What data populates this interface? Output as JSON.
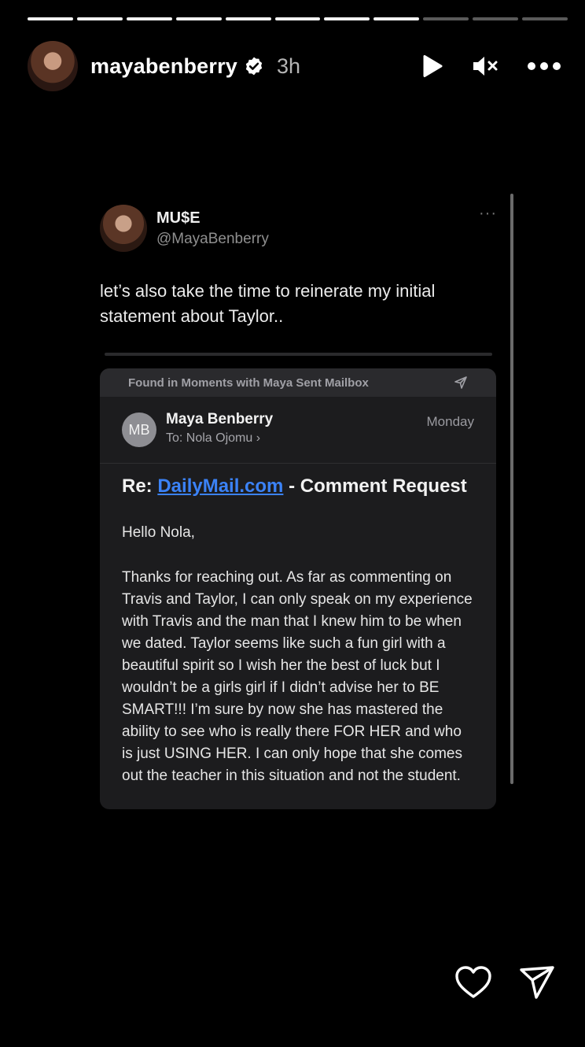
{
  "story": {
    "segments_total": 11,
    "segments_done": 8,
    "username": "mayabenberry",
    "time": "3h",
    "icons": {
      "verified": "verified-badge-icon",
      "play": "play-icon",
      "mute": "muted-speaker-icon",
      "more": "more-options-icon"
    }
  },
  "post": {
    "display_name": "MU$E",
    "handle": "@MayaBenberry",
    "more": "···",
    "text": "let’s also take the time to reinerate my initial statement about Taylor.."
  },
  "email": {
    "found_in": "Found in Moments with Maya Sent Mailbox",
    "avatar_initials": "MB",
    "sender": "Maya Benberry",
    "to_label": "To:",
    "to_name": "Nola Ojomu",
    "chevron": "›",
    "date": "Monday",
    "subject_prefix": "Re: ",
    "subject_link": "DailyMail.com",
    "subject_suffix": " - Comment Request",
    "greeting": "Hello Nola,",
    "body": "Thanks for reaching out. As far as commenting on Travis and Taylor, I can only speak on my experience with Travis and the man that I knew him to be when we dated. Taylor seems like such a fun girl with a beautiful spirit so I wish her the best of luck but I wouldn’t be a girls girl if I didn’t advise her to BE SMART!!! I’m sure by now she has mastered the ability to see who is really there FOR HER and who is just USING HER. I can only hope that she comes out the teacher in this situation and not the student."
  },
  "footer": {
    "icons": [
      "heart-icon",
      "send-icon"
    ]
  },
  "colors": {
    "background": "#000000",
    "link": "#3b82f6",
    "card": "#1c1c1e"
  }
}
